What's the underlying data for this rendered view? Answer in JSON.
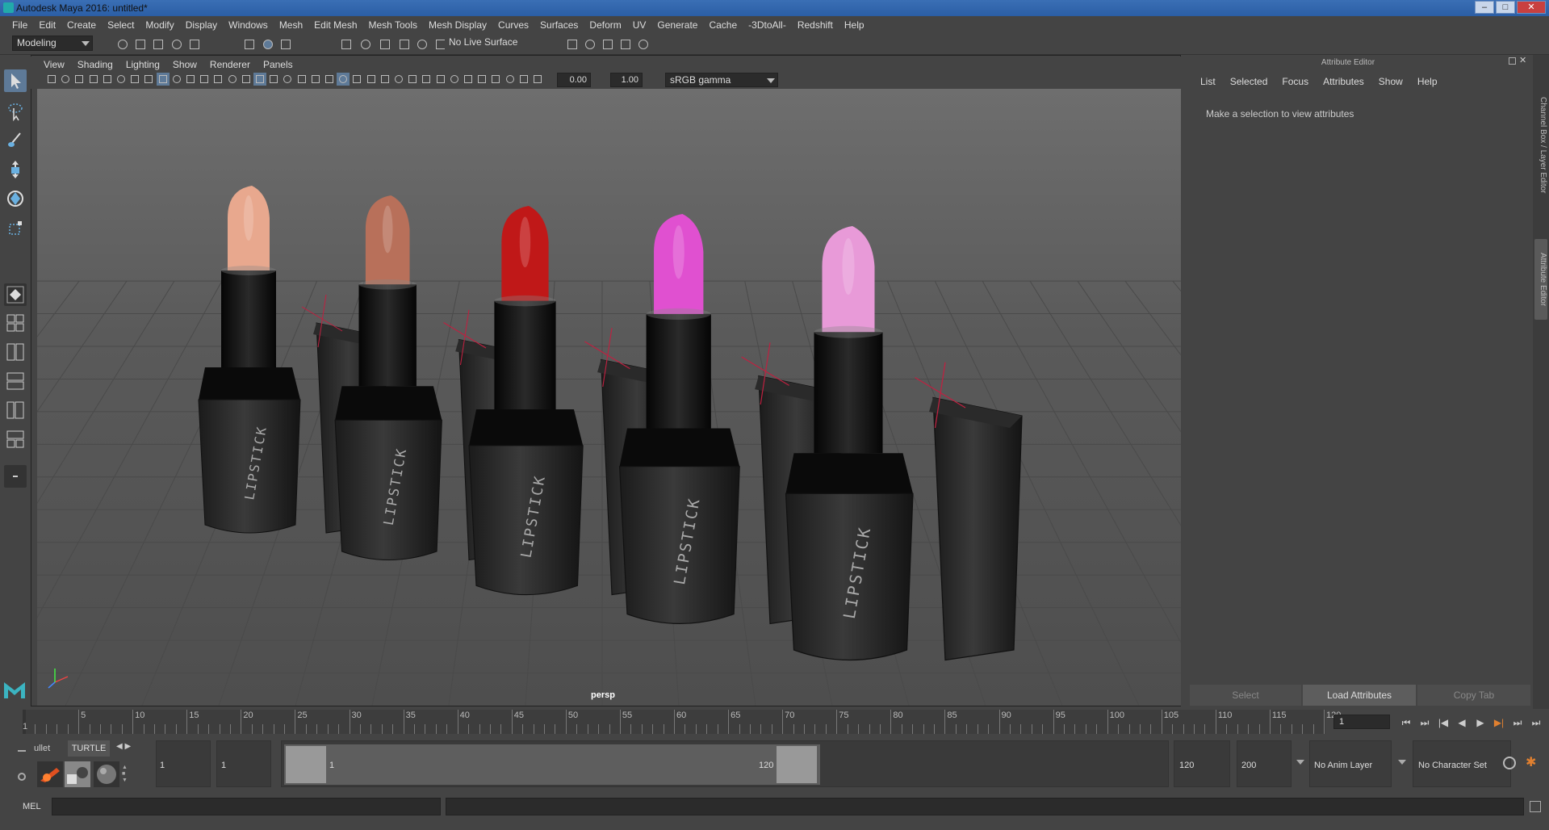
{
  "window": {
    "title": "Autodesk Maya 2016: untitled*",
    "controls": [
      "–",
      "□",
      "✕"
    ]
  },
  "menus": [
    "File",
    "Edit",
    "Create",
    "Select",
    "Modify",
    "Display",
    "Windows",
    "Mesh",
    "Edit Mesh",
    "Mesh Tools",
    "Mesh Display",
    "Curves",
    "Surfaces",
    "Deform",
    "UV",
    "Generate",
    "Cache",
    "-3DtoAll-",
    "Redshift",
    "Help"
  ],
  "shelf": {
    "mode": "Modeling",
    "live_surface": "No Live Surface"
  },
  "viewport": {
    "menus": [
      "View",
      "Shading",
      "Lighting",
      "Show",
      "Renderer",
      "Panels"
    ],
    "exposure": "0.00",
    "gamma": "1.00",
    "color_space": "sRGB gamma",
    "camera": "persp",
    "label_text": "LIPSTICK",
    "lipstick_colors": [
      "#e8a88e",
      "#b8705a",
      "#c01818",
      "#e050d0",
      "#e89ad8"
    ]
  },
  "attribute_editor": {
    "title": "Attribute Editor",
    "menus": [
      "List",
      "Selected",
      "Focus",
      "Attributes",
      "Show",
      "Help"
    ],
    "message": "Make a selection to view attributes",
    "buttons": {
      "select": "Select",
      "load": "Load Attributes",
      "copy": "Copy Tab"
    }
  },
  "side_tabs": {
    "channel_box": "Channel Box / Layer Editor",
    "attribute_editor": "Attribute Editor"
  },
  "timeline": {
    "ticks": [
      "5",
      "10",
      "15",
      "20",
      "25",
      "30",
      "35",
      "40",
      "45",
      "50",
      "55",
      "60",
      "65",
      "70",
      "75",
      "80",
      "85",
      "90",
      "95",
      "100",
      "105",
      "110",
      "115",
      "120"
    ],
    "start_label": "1",
    "current_frame": "1"
  },
  "range": {
    "shelf_tabs": [
      "ullet",
      "TURTLE"
    ],
    "start": "1",
    "playback_start": "1",
    "slider_start": "1",
    "slider_end": "120",
    "playback_end": "120",
    "end": "200",
    "anim_layer": "No Anim Layer",
    "character_set": "No Character Set"
  },
  "command": {
    "lang": "MEL"
  }
}
